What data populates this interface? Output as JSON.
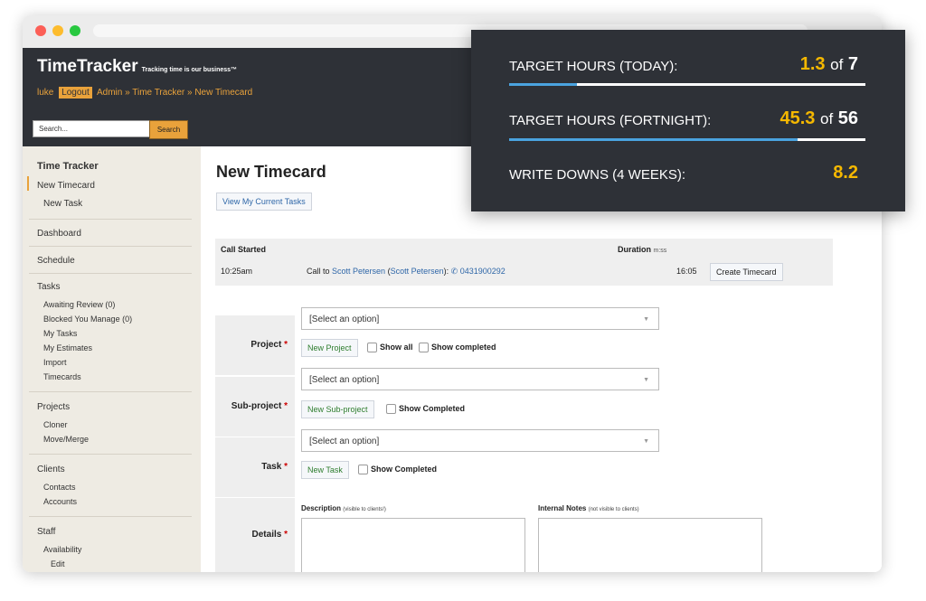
{
  "app": {
    "name": "TimeTracker",
    "tagline": "Tracking time is our business™",
    "user": "luke",
    "logout": "Logout",
    "breadcrumb": "Admin » Time Tracker » New Timecard"
  },
  "search": {
    "placeholder": "Search...",
    "button": "Search"
  },
  "sidebar": {
    "section_title": "Time Tracker",
    "items": [
      "New Timecard",
      "New Task",
      "Dashboard",
      "Schedule",
      "Tasks",
      "Awaiting Review (0)",
      "Blocked You Manage (0)",
      "My Tasks",
      "My Estimates",
      "Import",
      "Timecards",
      "Projects",
      "Cloner",
      "Move/Merge",
      "Clients",
      "Contacts",
      "Accounts",
      "Staff",
      "Availability",
      "Edit"
    ]
  },
  "main": {
    "title": "New Timecard",
    "view_tasks_button": "View My Current Tasks"
  },
  "call": {
    "header_started": "Call Started",
    "header_duration": "Duration",
    "duration_unit": "m:ss",
    "time": "10:25am",
    "call_prefix": "Call to",
    "contact": "Scott Petersen",
    "contact_paren": "Scott Petersen",
    "phone": "0431900292",
    "duration": "16:05",
    "create_button": "Create Timecard"
  },
  "form": {
    "project_label": "Project",
    "subproject_label": "Sub-project",
    "task_label": "Task",
    "details_label": "Details",
    "select_placeholder": "[Select an option]",
    "new_project": "New Project",
    "show_all": "Show all",
    "show_completed": "Show completed",
    "new_subproject": "New Sub-project",
    "show_completed_cap": "Show Completed",
    "new_task": "New Task",
    "description_label": "Description",
    "description_note": "(visible to clients!)",
    "internal_label": "Internal Notes",
    "internal_note": "(not visible to clients)"
  },
  "stats": {
    "today": {
      "label": "TARGET HOURS (TODAY):",
      "value": "1.3",
      "of": "of",
      "target": "7",
      "progress": 0.19
    },
    "fortnight": {
      "label": "TARGET HOURS (FORTNIGHT):",
      "value": "45.3",
      "of": "of",
      "target": "56",
      "progress": 0.81
    },
    "writedowns": {
      "label": "WRITE DOWNS (4 WEEKS):",
      "value": "8.2"
    }
  }
}
